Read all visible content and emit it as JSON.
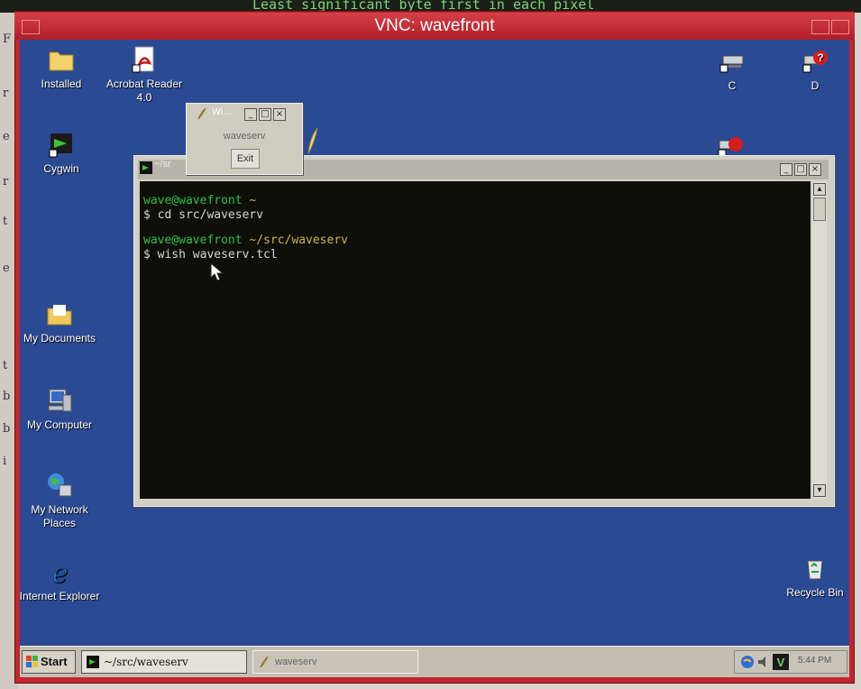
{
  "background": {
    "top_text": "Least significant byte first in each pixel",
    "left_glyphs": [
      "F",
      "r",
      "e",
      "r",
      "t",
      "e",
      "t",
      "b",
      "b",
      "i"
    ]
  },
  "vnc": {
    "title": "VNC: wavefront"
  },
  "desktop_icons": {
    "installed": "Installed",
    "acrobat": "Acrobat Reader 4.0",
    "cygwin": "Cygwin",
    "my_documents": "My Documents",
    "my_computer": "My Computer",
    "my_network_places": "My Network Places",
    "internet_explorer": "Internet Explorer",
    "drive_c": "C",
    "drive_d": "D",
    "recycle_bin": "Recycle Bin"
  },
  "wish_window": {
    "title": "Wi...",
    "label": "waveserv",
    "exit_button": "Exit"
  },
  "terminal": {
    "title": "~/sr",
    "lines": [
      {
        "prompt": "wave@wavefront",
        "path": " ~"
      },
      {
        "cmd": "$ cd src/waveserv"
      },
      {
        "prompt": "wave@wavefront",
        "path": " ~/src/waveserv"
      },
      {
        "cmd": "$ wish waveserv.tcl"
      }
    ]
  },
  "taskbar": {
    "start": "Start",
    "tasks": [
      {
        "label": "~/src/waveserv",
        "active": true
      },
      {
        "label": "waveserv",
        "active": false
      }
    ],
    "clock": "5:44 PM"
  },
  "colors": {
    "vnc_frame": "#c0262e",
    "desktop": "#2b4a94",
    "terminal_bg": "#0e0f09",
    "prompt_green": "#2ec246",
    "path_yellow": "#c6b840"
  }
}
